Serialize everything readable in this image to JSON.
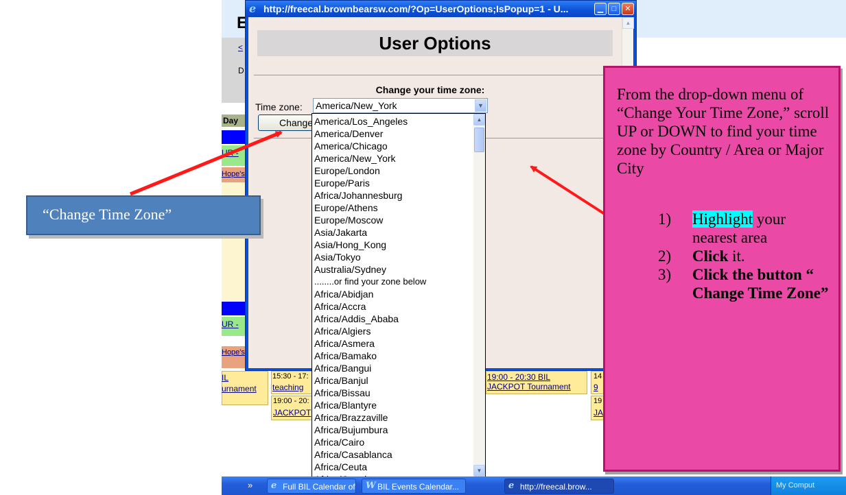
{
  "popup": {
    "title_bar": "http://freecal.brownbearsw.com/?Op=UserOptions;IsPopup=1 - U...",
    "heading": "User Options",
    "tz_heading": "Change your time zone:",
    "tz_label": "Time zone:",
    "tz_value": "America/New_York",
    "change_button": "Change Time Zone"
  },
  "dropdown": {
    "options": [
      "America/Los_Angeles",
      "America/Denver",
      "America/Chicago",
      "America/New_York",
      "Europe/London",
      "Europe/Paris",
      "Africa/Johannesburg",
      "Europe/Athens",
      "Europe/Moscow",
      "Asia/Jakarta",
      "Asia/Hong_Kong",
      "Asia/Tokyo",
      "Australia/Sydney",
      "........or find your zone below",
      "Africa/Abidjan",
      "Africa/Accra",
      "Africa/Addis_Ababa",
      "Africa/Algiers",
      "Africa/Asmera",
      "Africa/Bamako",
      "Africa/Bangui",
      "Africa/Banjul",
      "Africa/Bissau",
      "Africa/Blantyre",
      "Africa/Brazzaville",
      "Africa/Bujumbura",
      "Africa/Cairo",
      "Africa/Casablanca",
      "Africa/Ceuta",
      "Africa/Conakry"
    ]
  },
  "background": {
    "header_letter": "E",
    "nav_left": "<",
    "line_letter": "D",
    "day_header": "Day",
    "band1_text": "UR -",
    "hope1": "Hope's",
    "band2_text": "UR -",
    "hope2": "Hope's",
    "cell1_line1": "IL",
    "cell1_line2": "urnament",
    "cell2_line1": "15:30 - 17:",
    "cell2_line2": "teaching",
    "cell3_line1": "19:00 - 20:",
    "cell3_line2": "JACKPOT",
    "cell4_line1": "19:00 - 20:30 BIL",
    "cell4_line2": "JACKPOT Tournament",
    "cell5_line1": "14",
    "cell5_line2": "9",
    "cell6_line1": "19",
    "cell6_line2": "JA"
  },
  "taskbar": {
    "chevron": "»",
    "tasks": [
      "Full BIL Calendar of ...",
      "BIL Events Calendar...",
      "http://freecal.brow..."
    ],
    "tray": "My Comput"
  },
  "callouts": {
    "left": "“Change Time Zone”",
    "right_intro": "From the drop-down menu of “Change Your Time Zone,” scroll UP or DOWN to find your time zone by Country / Area or Major City",
    "step1_num": "1)",
    "step1_highlight": "Highlight",
    "step1_rest": " your nearest area",
    "step2_num": "2)",
    "step2_bold": "Click",
    "step2_rest": " it.",
    "step3_num": "3)",
    "step3_bold": "Click the button “ Change Time Zone”"
  },
  "colors": {
    "popup_frame": "#0a4fd8",
    "popup_client": "#f2e8e4",
    "callout_left": "#4f81bd",
    "callout_right": "#ea4aa6",
    "arrow": "#ff1a1a",
    "highlight": "#00ffff"
  }
}
